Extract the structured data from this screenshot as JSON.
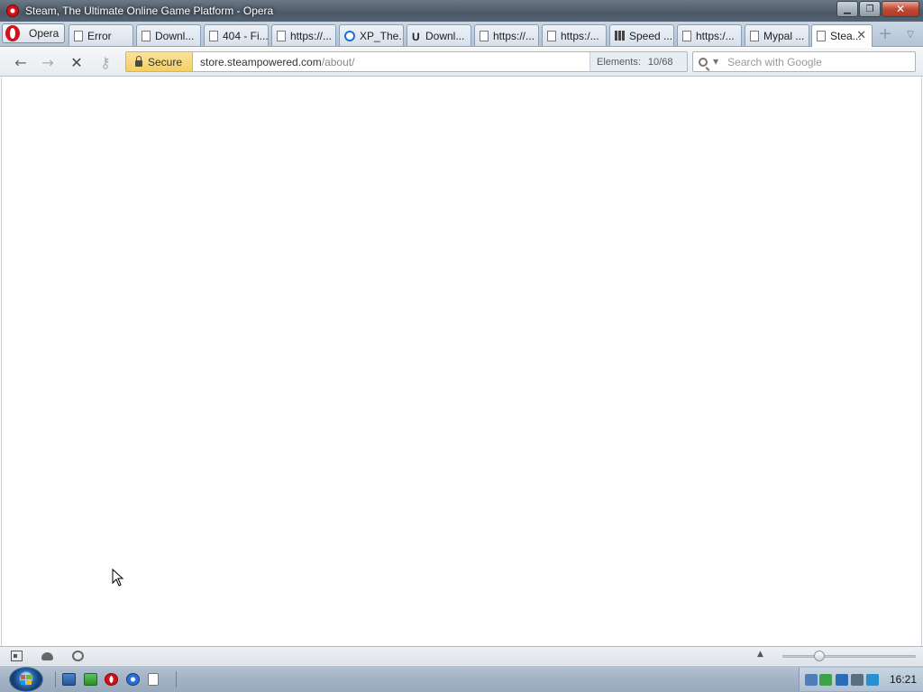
{
  "window": {
    "title": "Steam, The Ultimate Online Game Platform - Opera",
    "minimize_label": "▁",
    "maximize_label": "❐",
    "close_label": "✕"
  },
  "menu": {
    "label": "Opera"
  },
  "tabs": [
    {
      "label": "Error",
      "icon": "page-icon"
    },
    {
      "label": "Downl...",
      "icon": "page-icon"
    },
    {
      "label": "404 - Fi...",
      "icon": "page-icon"
    },
    {
      "label": "https://...",
      "icon": "page-icon"
    },
    {
      "label": "XP_The...",
      "icon": "globe-icon"
    },
    {
      "label": "Downl...",
      "icon": "magnet-icon"
    },
    {
      "label": "https://...",
      "icon": "page-icon"
    },
    {
      "label": "https:/...",
      "icon": "page-icon"
    },
    {
      "label": "Speed ...",
      "icon": "grid-icon"
    },
    {
      "label": "https:/...",
      "icon": "page-icon"
    },
    {
      "label": "Mypal ...",
      "icon": "page-icon"
    },
    {
      "label": "Stea...",
      "icon": "page-icon",
      "active": true
    }
  ],
  "tab_close": "✕",
  "new_tab": "+",
  "tab_menu": "▽",
  "nav": {
    "back": "←",
    "forward": "→",
    "stop": "✕",
    "key": "⚷"
  },
  "address": {
    "secure_label": "Secure",
    "host": "store.steampowered.com",
    "path": "/about/",
    "elements_label": "Elements:",
    "elements_value": "10/68"
  },
  "search": {
    "placeholder": "Search with Google",
    "value": ""
  },
  "statusbar": {
    "zoom_fraction": 0.28
  },
  "taskbar": {
    "clock": "16:21"
  },
  "colors": {
    "secure_badge": "#f5cf63",
    "opera_red": "#d0131b",
    "taskbar": "#a3b3c5"
  }
}
